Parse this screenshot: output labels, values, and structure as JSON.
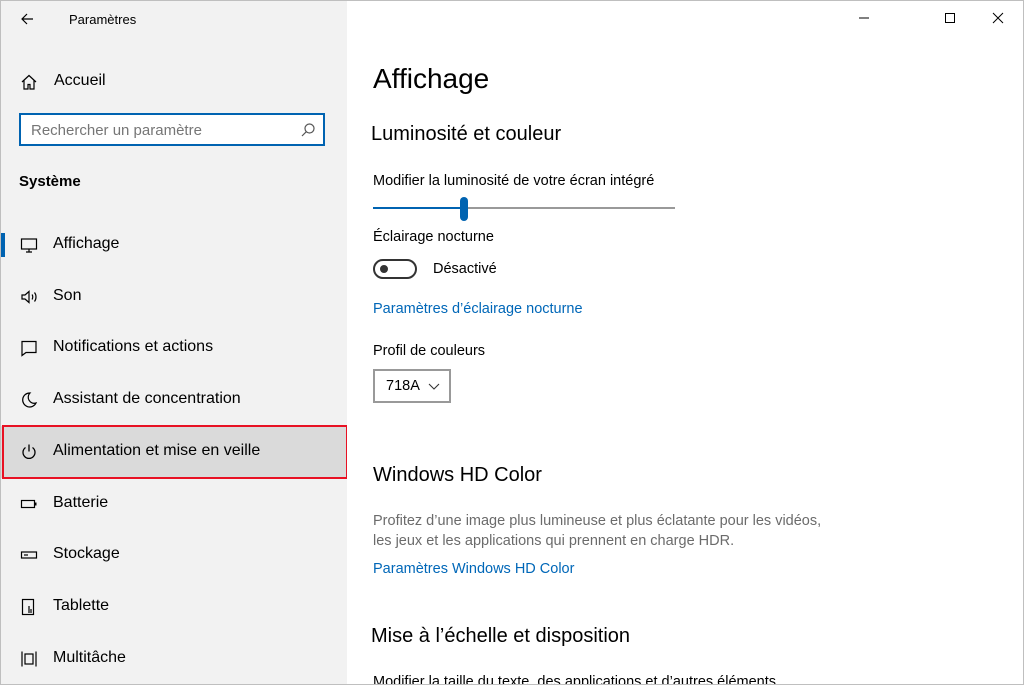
{
  "window": {
    "title": "Paramètres",
    "controls": {
      "minimize": "minimize-icon",
      "maximize": "maximize-icon",
      "close": "close-icon"
    }
  },
  "sidebar": {
    "home_label": "Accueil",
    "search": {
      "placeholder": "Rechercher un paramètre",
      "value": ""
    },
    "section_title": "Système",
    "items": [
      {
        "label": "Affichage",
        "icon": "monitor-icon",
        "selected": true
      },
      {
        "label": "Son",
        "icon": "speaker-icon"
      },
      {
        "label": "Notifications et actions",
        "icon": "notification-icon"
      },
      {
        "label": "Assistant de concentration",
        "icon": "moon-icon"
      },
      {
        "label": "Alimentation et mise en veille",
        "icon": "power-icon",
        "highlighted": true
      },
      {
        "label": "Batterie",
        "icon": "battery-icon"
      },
      {
        "label": "Stockage",
        "icon": "storage-icon"
      },
      {
        "label": "Tablette",
        "icon": "tablet-icon"
      },
      {
        "label": "Multitâche",
        "icon": "multitask-icon"
      }
    ]
  },
  "main": {
    "page_title": "Affichage",
    "brightness_section": {
      "title": "Luminosité et couleur",
      "slider_label": "Modifier la luminosité de votre écran intégré",
      "slider_value": 0.3
    },
    "night_light": {
      "label": "Éclairage nocturne",
      "state": "Désactivé",
      "settings_link": "Paramètres d’éclairage nocturne"
    },
    "color_profile": {
      "label": "Profil de couleurs",
      "value": "718A"
    },
    "hd_color": {
      "title": "Windows HD Color",
      "description_line1": "Profitez d’une image plus lumineuse et plus éclatante pour les vidéos,",
      "description_line2": "les jeux et les applications qui prennent en charge HDR.",
      "link": "Paramètres Windows HD Color"
    },
    "scale_section": {
      "title": "Mise à l’échelle et disposition",
      "text": "Modifier la taille du texte, des applications et d’autres éléments"
    }
  },
  "colors": {
    "accent": "#0063b1",
    "link": "#0067b8",
    "highlight_border": "#e81123",
    "sidebar_bg": "#f2f2f2"
  }
}
